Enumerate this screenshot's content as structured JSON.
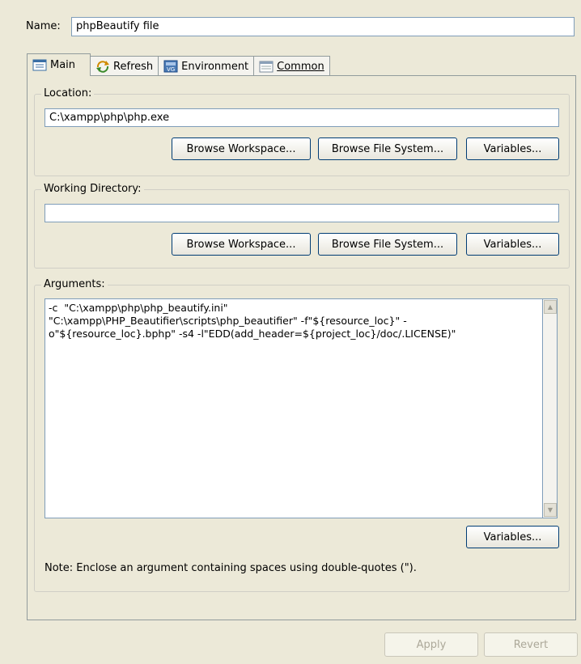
{
  "name": {
    "label": "Name:",
    "value": "phpBeautify file"
  },
  "tabs": [
    {
      "label": "Main",
      "icon": "main-tab-icon",
      "active": true
    },
    {
      "label": "Refresh",
      "icon": "refresh-icon"
    },
    {
      "label": "Environment",
      "icon": "environment-icon"
    },
    {
      "label": "Common",
      "icon": "common-icon"
    }
  ],
  "location": {
    "legend": "Location:",
    "value": "C:\\xampp\\php\\php.exe",
    "browse_workspace": "Browse Workspace...",
    "browse_file_system": "Browse File System...",
    "variables": "Variables..."
  },
  "working_directory": {
    "legend": "Working Directory:",
    "value": "",
    "browse_workspace": "Browse Workspace...",
    "browse_file_system": "Browse File System...",
    "variables": "Variables..."
  },
  "arguments": {
    "legend": "Arguments:",
    "value": "-c  \"C:\\xampp\\php\\php_beautify.ini\"\n\"C:\\xampp\\PHP_Beautifier\\scripts\\php_beautifier\" -f\"${resource_loc}\" -\no\"${resource_loc}.bphp\" -s4 -l\"EDD(add_header=${project_loc}/doc/.LICENSE)\"",
    "variables": "Variables...",
    "note": "Note: Enclose an argument containing spaces using double-quotes (\")."
  },
  "footer": {
    "apply": "Apply",
    "revert": "Revert"
  },
  "colors": {
    "window_bg": "#ece9d8",
    "field_border": "#7f9db9",
    "tab_border": "#919b9c"
  }
}
